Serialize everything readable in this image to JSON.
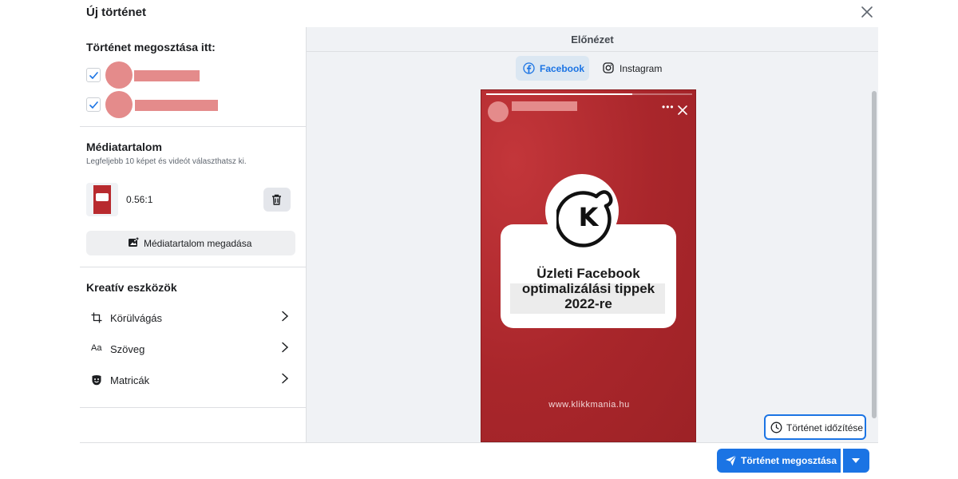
{
  "header": {
    "title": "Új történet",
    "close_icon": "close-icon"
  },
  "share_section": {
    "title": "Történet megosztása itt:",
    "accounts": [
      {
        "checked": true
      },
      {
        "checked": true
      }
    ]
  },
  "media_section": {
    "title": "Médiatartalom",
    "subtitle": "Legfeljebb 10 képet és videót választhatsz ki.",
    "item": {
      "ratio": "0.56:1"
    },
    "add_label": "Médiatartalom megadása"
  },
  "creative_section": {
    "title": "Kreatív eszközök",
    "tools": [
      {
        "label": "Körülvágás",
        "icon": "crop-icon"
      },
      {
        "label": "Szöveg",
        "icon": "text-icon",
        "icon_text": "Aa"
      },
      {
        "label": "Matricák",
        "icon": "sticker-icon"
      }
    ]
  },
  "preview": {
    "title": "Előnézet",
    "tabs": [
      {
        "label": "Facebook",
        "active": true
      },
      {
        "label": "Instagram",
        "active": false
      }
    ],
    "story": {
      "progress": 0.71,
      "headline_lines": [
        "Üzleti Facebook",
        "optimalizálási tippek",
        "2022-re"
      ],
      "logo_letter": "K",
      "url": "www.klikkmania.hu"
    }
  },
  "actions": {
    "schedule_label": "Történet időzítése",
    "share_label": "Történet megosztása"
  },
  "colors": {
    "primary": "#1b74e4",
    "story_red": "#a9262b",
    "redaction": "#e48b8b"
  }
}
